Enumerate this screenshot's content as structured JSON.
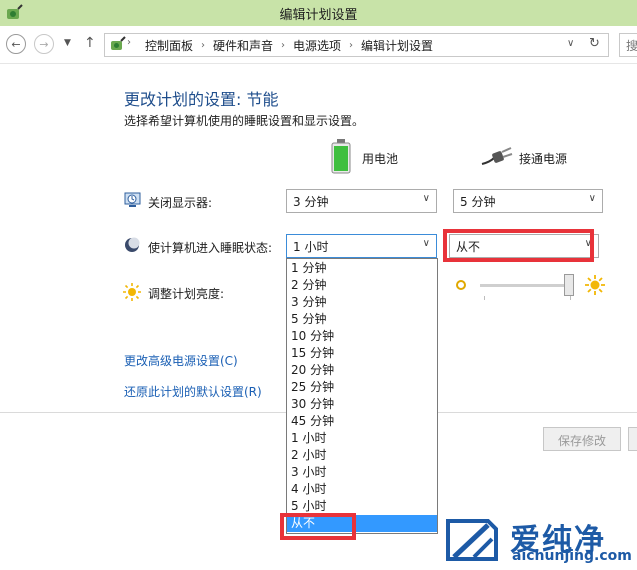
{
  "window": {
    "title": "编辑计划设置"
  },
  "nav": {
    "back_icon": "back-arrow-icon",
    "forward_icon": "forward-arrow-icon",
    "breadcrumbs": [
      "控制面板",
      "硬件和声音",
      "电源选项",
      "编辑计划设置"
    ],
    "search_text": "搜"
  },
  "main": {
    "heading": "更改计划的设置: 节能",
    "subheading": "选择希望计算机使用的睡眠设置和显示设置。",
    "columns": {
      "battery": "用电池",
      "plugged": "接通电源"
    },
    "rows": [
      {
        "label": "关闭显示器:",
        "battery_value": "3 分钟",
        "plugged_value": "5 分钟"
      },
      {
        "label": "使计算机进入睡眠状态:",
        "battery_value": "1 小时",
        "plugged_value": "从不"
      },
      {
        "label": "调整计划亮度:"
      }
    ],
    "brightness_level": 1.0,
    "links": {
      "advanced": "更改高级电源设置(C)",
      "restore": "还原此计划的默认设置(R)"
    },
    "buttons": {
      "save": "保存修改"
    }
  },
  "dropdown": {
    "options": [
      "1 分钟",
      "2 分钟",
      "3 分钟",
      "5 分钟",
      "10 分钟",
      "15 分钟",
      "20 分钟",
      "25 分钟",
      "30 分钟",
      "45 分钟",
      "1 小时",
      "2 小时",
      "3 小时",
      "4 小时",
      "5 小时",
      "从不"
    ],
    "selected": "从不"
  },
  "watermark": {
    "text": "爱纯净",
    "url": "aichunjing.com"
  },
  "colors": {
    "accent_link": "#1a5fb4",
    "heading": "#1f4e8c",
    "highlight": "#e8333a",
    "selection": "#3399ff",
    "titlebar": "#c8e3a8"
  }
}
